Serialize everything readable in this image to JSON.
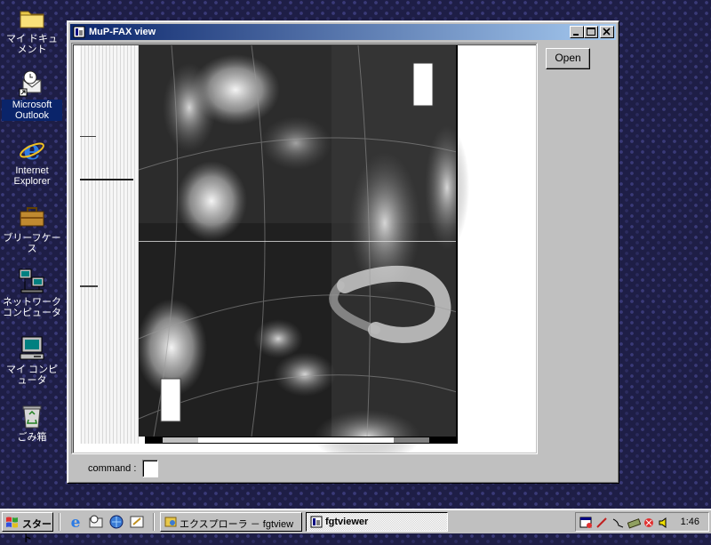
{
  "desktop": {
    "icons": [
      {
        "label": "マイ ドキュメント"
      },
      {
        "label": "Microsoft Outlook"
      },
      {
        "label": "Internet Explorer"
      },
      {
        "label": "ブリーフケース"
      },
      {
        "label": "ネットワーク コンピュータ"
      },
      {
        "label": "マイ コンピュータ"
      },
      {
        "label": "ごみ箱"
      }
    ]
  },
  "window": {
    "title": "MuP-FAX view",
    "open_button": "Open",
    "command_label": "command :",
    "command_value": "",
    "image_icon": "satellite-fax-image"
  },
  "taskbar": {
    "start_label": "スタート",
    "tasks": [
      {
        "label": "エクスプローラ － fgtview"
      },
      {
        "label": "fgtviewer"
      }
    ],
    "clock": "1:46"
  },
  "colors": {
    "titlebar_start": "#0a246a",
    "titlebar_end": "#a6caf0",
    "face": "#c0c0c0",
    "desktop": "#1e1e46"
  }
}
